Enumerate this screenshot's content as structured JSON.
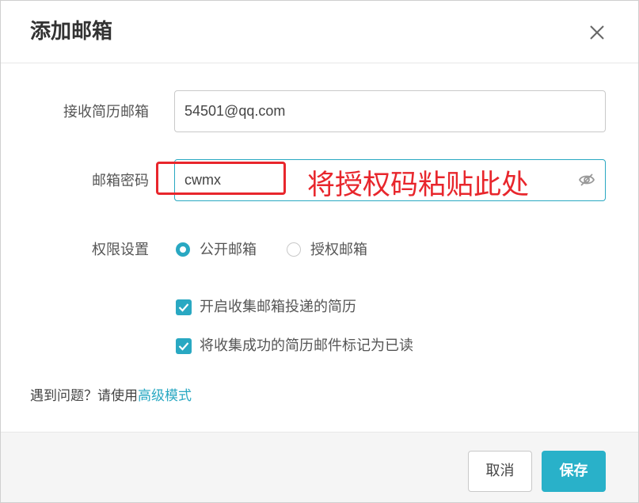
{
  "dialog": {
    "title": "添加邮箱",
    "close_icon": "close-icon"
  },
  "form": {
    "email": {
      "label": "接收简历邮箱",
      "value": "54501@qq.com"
    },
    "password": {
      "label": "邮箱密码",
      "value": "cwmx",
      "toggle_icon": "eye-off-icon"
    },
    "permission": {
      "label": "权限设置",
      "options": [
        {
          "label": "公开邮箱",
          "checked": true
        },
        {
          "label": "授权邮箱",
          "checked": false
        }
      ]
    },
    "checkboxes": [
      {
        "label": "开启收集邮箱投递的简历",
        "checked": true
      },
      {
        "label": "将收集成功的简历邮件标记为已读",
        "checked": true
      }
    ]
  },
  "annotation": {
    "text": "将授权码粘贴此处",
    "color": "#e8262c"
  },
  "help": {
    "prefix": "遇到问题？请使用",
    "link": "高级模式"
  },
  "footer": {
    "cancel_label": "取消",
    "save_label": "保存"
  },
  "colors": {
    "accent": "#29a8c2",
    "save_button": "#29b1c9"
  }
}
